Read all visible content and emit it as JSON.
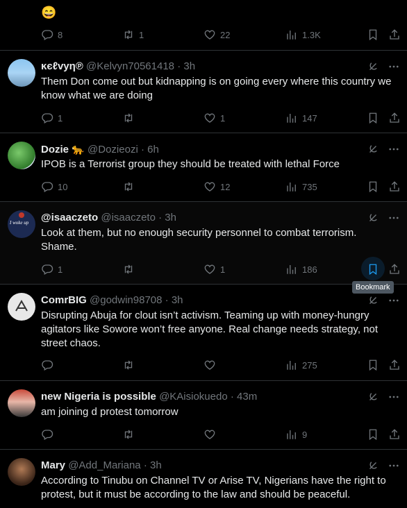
{
  "top": {
    "emoji": "😄",
    "reply_count": "8",
    "repost_count": "1",
    "like_count": "22",
    "view_count": "1.3K"
  },
  "tweets": [
    {
      "name": "ĸєℓvуη℗",
      "handle": "@Kelvyn70561418",
      "time": "· 3h",
      "text": "Them Don come out but kidnapping is on going every where this country we know what we are doing",
      "replies": "1",
      "reposts": "",
      "likes": "1",
      "views": "147",
      "avatar_color": "#6fa7d3"
    },
    {
      "name": "Dozie 🐆",
      "handle": "@Dozieozi",
      "time": "· 6h",
      "text": "IPOB is a Terrorist group they should be treated with lethal Force",
      "replies": "10",
      "reposts": "",
      "likes": "12",
      "views": "735",
      "avatar_color": "#3c8a3a"
    },
    {
      "name": "@isaaczeto",
      "handle": "@isaaczeto",
      "time": "· 3h",
      "text": "Look at them, but no enough security personnel to combat terrorism. Shame.",
      "replies": "1",
      "reposts": "",
      "likes": "1",
      "views": "186",
      "avatar_color": "#1c2a52",
      "avatar_text": "I woke up"
    },
    {
      "name": "ComrBIG",
      "handle": "@godwin98708",
      "time": "· 3h",
      "text": "Disrupting Abuja for clout isn’t activism. Teaming up with money-hungry agitators like Sowore won’t free anyone. Real change needs strategy, not street chaos.",
      "replies": "",
      "reposts": "",
      "likes": "",
      "views": "275",
      "avatar_color": "#e8e8e8"
    },
    {
      "name": "new Nigeria is possible",
      "handle": "@KAisiokuedo",
      "time": "· 43m",
      "text": "am joining d protest tomorrow",
      "replies": "",
      "reposts": "",
      "likes": "",
      "views": "9",
      "avatar_color": "#b03a2e"
    },
    {
      "name": "Mary",
      "handle": "@Add_Mariana",
      "time": "· 3h",
      "text": "According to Tinubu on Channel TV or Arise TV, Nigerians have the right to protest, but it must be according to the law and should be peaceful.",
      "avatar_color": "#5a3b2a"
    }
  ],
  "tooltip": "Bookmark",
  "colors": {
    "bg": "#000000",
    "text": "#e7e9ea",
    "muted": "#71767b",
    "accent": "#1d9bf0",
    "divider": "#2f3336"
  }
}
